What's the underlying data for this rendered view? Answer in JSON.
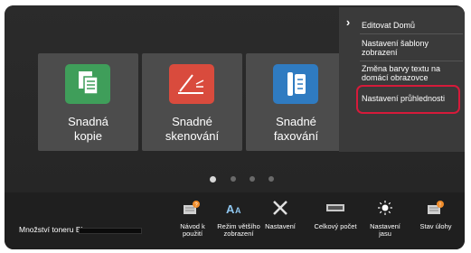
{
  "tiles": [
    {
      "label": "Snadná\nkopie",
      "icon": "copy-icon"
    },
    {
      "label": "Snadné\nskenování",
      "icon": "scan-icon"
    },
    {
      "label": "Snadné\nfaxování",
      "icon": "fax-icon"
    }
  ],
  "page_indicator": {
    "count": 4,
    "active": 1
  },
  "menu": {
    "items": [
      {
        "label": "Editovat Domů"
      },
      {
        "label": "Nastavení šablony zobrazení"
      },
      {
        "label": "Změna barvy textu na domácí obrazovce"
      },
      {
        "label": "Nastavení průhlednosti"
      }
    ],
    "highlighted": "Nastavení průhlednosti"
  },
  "toner": {
    "label": "Množství toneru Bk"
  },
  "bottom_icons": [
    {
      "label": "Návod k\npoužití",
      "icon": "guide-icon"
    },
    {
      "label": "Režim většího\nzobrazení",
      "icon": "text-size-icon"
    },
    {
      "label": "Nastavení",
      "icon": "settings-tools-icon"
    },
    {
      "label": "Celkový počet",
      "icon": "counter-icon"
    },
    {
      "label": "Nastavení\njasu",
      "icon": "brightness-icon"
    },
    {
      "label": "Stav úlohy",
      "icon": "job-status-icon"
    }
  ],
  "colors": {
    "highlight": "#d61a3a",
    "copy": "#3f9e5a",
    "scan": "#d94b3d",
    "fax": "#2f7bc1",
    "badge": "#f08c2a"
  }
}
